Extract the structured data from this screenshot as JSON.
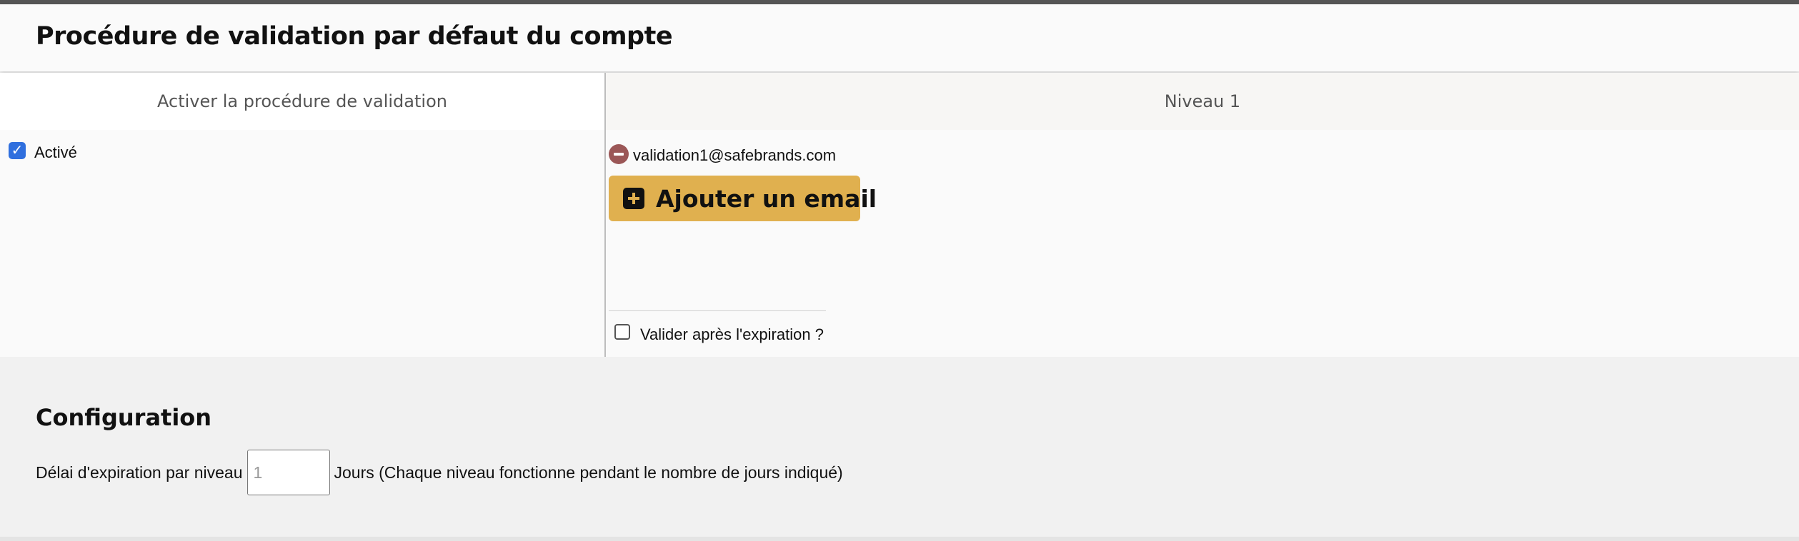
{
  "header": {
    "title": "Procédure de validation par défaut du compte"
  },
  "table": {
    "columns": [
      "Activer la procédure de validation",
      "Niveau 1"
    ],
    "activate": {
      "checked": true,
      "label": "Activé"
    },
    "level1": {
      "emails": [
        "validation1@safebrands.com"
      ],
      "add_email_label": "Ajouter un email",
      "validate_after_expiration": {
        "checked": false,
        "label": "Valider après l'expiration ?"
      }
    }
  },
  "configuration": {
    "title": "Configuration",
    "delay_label": "Délai d'expiration par niveau",
    "delay_value": "1",
    "delay_suffix": "Jours (Chaque niveau fonctionne pendant le nombre de jours indiqué)"
  },
  "colors": {
    "accent_button": "#e0b04f",
    "checkbox_blue": "#2f6fde",
    "remove_icon": "#9b5757"
  }
}
